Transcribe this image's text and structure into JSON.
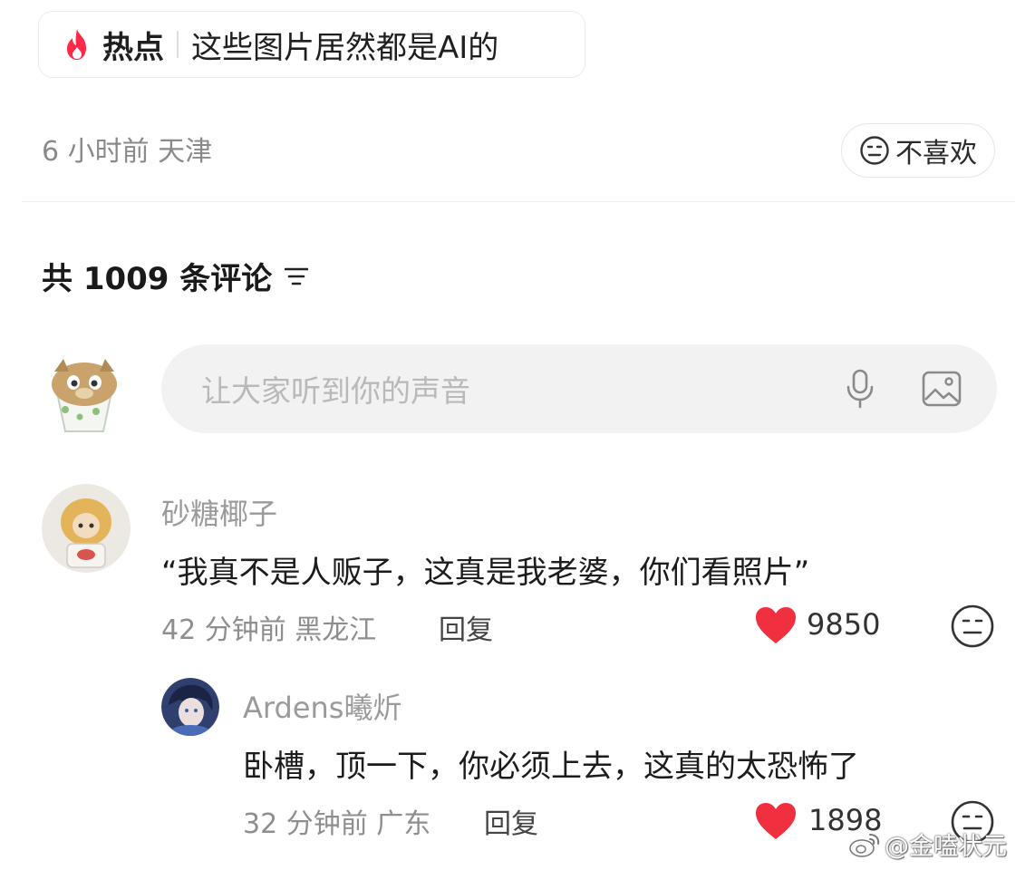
{
  "hot_topic": {
    "icon": "flame-icon",
    "label": "热点",
    "title": "这些图片居然都是AI的"
  },
  "post_meta": "6 小时前 天津",
  "dislike_button": {
    "icon": "meh-face-icon",
    "label": "不喜欢"
  },
  "comments_header": {
    "label": "共 1009 条评论",
    "sort_icon": "sort-lines-icon"
  },
  "input": {
    "placeholder": "让大家听到你的声音",
    "mic_icon": "microphone-icon",
    "image_icon": "image-icon"
  },
  "comments": [
    {
      "username": "砂糖椰子",
      "text": "“我真不是人贩子，这真是我老婆，你们看照片”",
      "meta": "42 分钟前 黑龙江",
      "reply_label": "回复",
      "likes": "9850"
    }
  ],
  "replies": [
    {
      "username": "Ardens曦炘",
      "text": "卧槽，顶一下，你必须上去，这真的太恐怖了",
      "meta": "32 分钟前 广东",
      "reply_label": "回复",
      "likes": "1898"
    }
  ],
  "watermark": "@金嗑状元",
  "colors": {
    "heart": "#f0303f",
    "flame": "#ff2a4a",
    "input_bg": "#f2f2f2",
    "muted_text": "#8e8e8e"
  }
}
